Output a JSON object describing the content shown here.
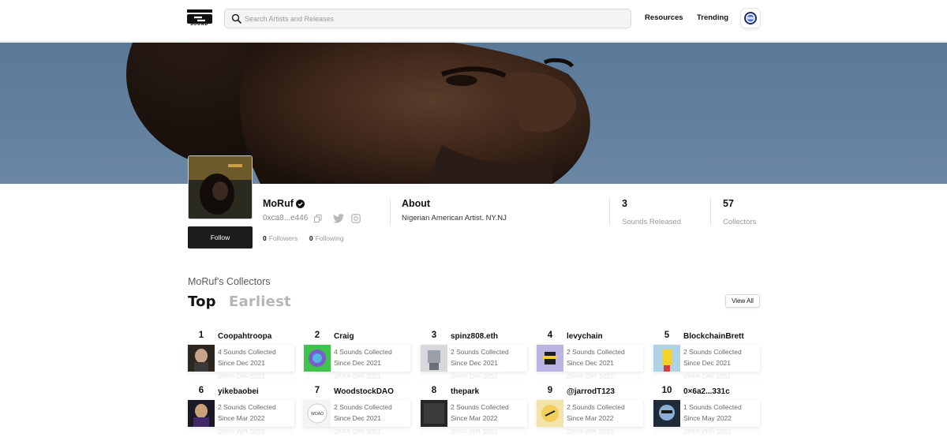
{
  "header": {
    "logo_text": "SOUND",
    "search_placeholder": "Search Artists and Releases",
    "nav": {
      "resources": "Resources",
      "trending": "Trending"
    }
  },
  "profile": {
    "name": "MoRuf",
    "wallet": "0xca8...e446",
    "follow_label": "Follow",
    "followers_count": "0",
    "followers_label": "Followers",
    "following_count": "0",
    "following_label": "Following",
    "about_title": "About",
    "about_text": "Nigerian American Artist. NY.NJ",
    "sounds_released": "3",
    "sounds_released_label": "Sounds Released",
    "collectors": "57",
    "collectors_label": "Collectors"
  },
  "collectors_section": {
    "title": "MoRuf's Collectors",
    "tab_top": "Top",
    "tab_earliest": "Earliest",
    "view_all": "View All",
    "items": [
      {
        "rank": "1",
        "name": "Coopahtroopa",
        "collected": "4 Sounds Collected",
        "since": "Since Dec 2021",
        "reflection": "Since Dec 2021"
      },
      {
        "rank": "2",
        "name": "Craig",
        "collected": "4 Sounds Collected",
        "since": "Since Dec 2021",
        "reflection": "Since Dec 2021"
      },
      {
        "rank": "3",
        "name": "spinz808.eth",
        "collected": "2 Sounds Collected",
        "since": "Since Dec 2021",
        "reflection": "Since Dec 2021"
      },
      {
        "rank": "4",
        "name": "levychain",
        "collected": "2 Sounds Collected",
        "since": "Since Dec 2021",
        "reflection": "Since Dec 2021"
      },
      {
        "rank": "5",
        "name": "BlockchainBrett",
        "collected": "2 Sounds Collected",
        "since": "Since Dec 2021",
        "reflection": "Since Dec 2021"
      },
      {
        "rank": "6",
        "name": "yikebaobei",
        "collected": "2 Sounds Collected",
        "since": "Since Mar 2022",
        "reflection": "Since Mar 2022"
      },
      {
        "rank": "7",
        "name": "WoodstockDAO",
        "collected": "2 Sounds Collected",
        "since": "Since Dec 2021",
        "reflection": "Since Dec 2021"
      },
      {
        "rank": "8",
        "name": "thepark",
        "collected": "2 Sounds Collected",
        "since": "Since Mar 2022",
        "reflection": "Since Mar 2022"
      },
      {
        "rank": "9",
        "name": "@jarrodT123",
        "collected": "2 Sounds Collected",
        "since": "Since Mar 2022",
        "reflection": "Since Mar 2022"
      },
      {
        "rank": "10",
        "name": "0×6a2...331c",
        "collected": "1 Sounds Collected",
        "since": "Since May 2022",
        "reflection": "Since May 2022"
      }
    ]
  },
  "colors": {
    "primary_button": "#1c1c1c",
    "banner_sky": "#5f7d99",
    "muted_text": "#999999"
  }
}
